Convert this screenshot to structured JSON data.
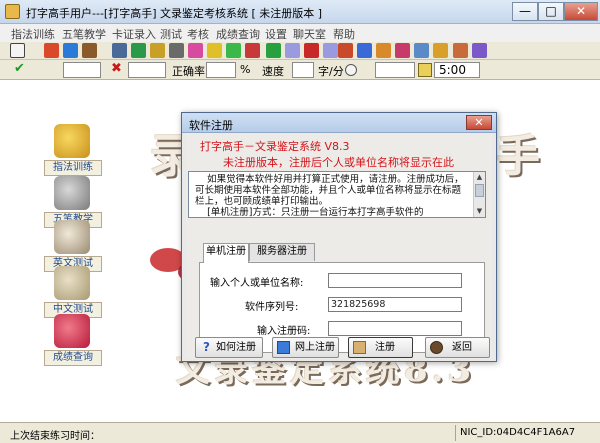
{
  "window": {
    "title": "打字高手用户---[打字高手]   文录鉴定考核系统 [ 未注册版本 ]",
    "min_symbol": "—",
    "max_symbol": "□",
    "close_symbol": "✕"
  },
  "menu": [
    "指法训练",
    "五笔教学",
    "卡证录入",
    "测试",
    "考核",
    "成绩查询",
    "设置",
    "聊天室",
    "帮助"
  ],
  "toolbar2": {
    "correct_icon": "✔",
    "wrong_icon": "✖",
    "accuracy_label": "正确率",
    "percent_label": "%",
    "speed_label": "速度",
    "speed_unit": "字/分",
    "time_value": "5:00"
  },
  "sidebar": [
    {
      "label": "指法训练",
      "icon": "star-icon"
    },
    {
      "label": "五笔教学",
      "icon": "hand-icon"
    },
    {
      "label": "英文测试",
      "icon": "shell-icon"
    },
    {
      "label": "中文测试",
      "icon": "chinese-test-icon"
    },
    {
      "label": "成绩查询",
      "icon": "gift-icon"
    }
  ],
  "dialog": {
    "title": "软件注册",
    "close_symbol": "✕",
    "heading": "打字高手－文录鉴定系统 V8.3",
    "subheading": "未注册版本，注册后个人或单位名称将显示在此",
    "notice": "    如果觉得本软件好用并打算正式使用，请注册。注册成功后，可长期使用本软件全部功能，并且个人或单位名称将显示在标题栏上，也可顾成绩单打印输出。\n    [单机注册]方式：只注册一台运行本打字高手软件的",
    "tabs": [
      "单机注册",
      "服务器注册"
    ],
    "fields": {
      "name_label": "输入个人或单位名称:",
      "name_value": "",
      "serial_label": "软件序列号:",
      "serial_value": "321825698",
      "code_label": "输入注册码:",
      "code_value": ""
    },
    "buttons": {
      "howto": "如何注册",
      "online": "网上注册",
      "register": "注册",
      "back": "返回"
    }
  },
  "statusbar": {
    "last_practice": "上次结束练习时间：",
    "nic_id": "NIC_ID:04D4C4F1A6A7"
  },
  "colors": {
    "dialog_heading": "#d4141a",
    "sidebar_label": "#1e4a8a"
  }
}
